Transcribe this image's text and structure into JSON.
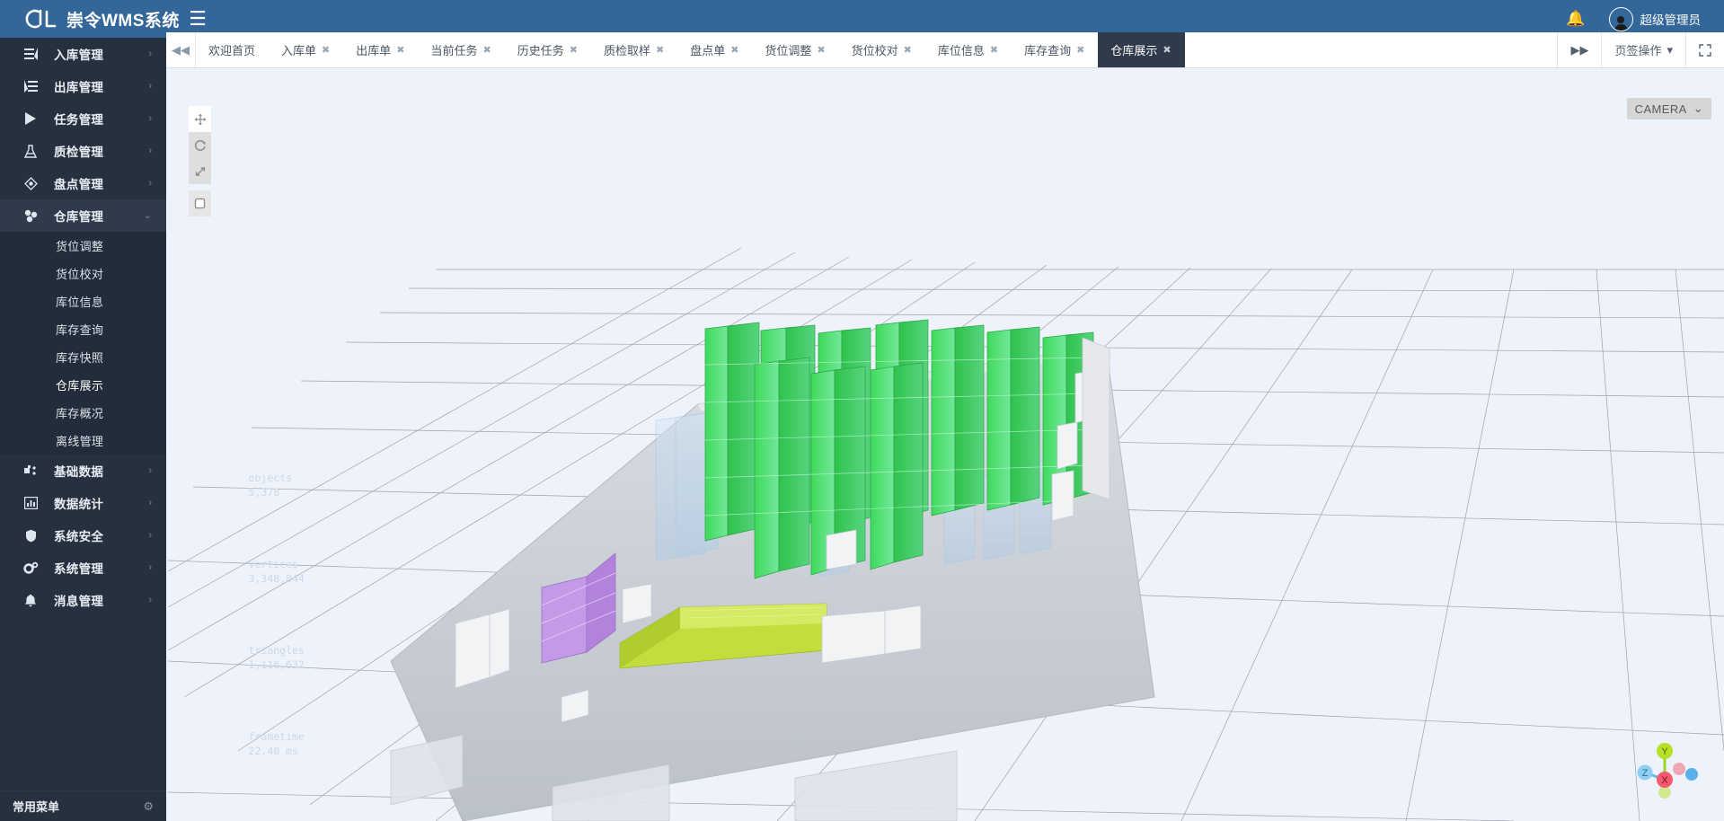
{
  "header": {
    "logo_text": "崇令WMS系统",
    "logo_icon": "cl-logo-icon",
    "hamburger_icon": "hamburger-icon",
    "bell_icon": "bell-icon",
    "user_name": "超级管理员"
  },
  "sidebar": {
    "items": [
      {
        "label": "入库管理",
        "icon": "inbound-icon",
        "arrow": "›",
        "open": false
      },
      {
        "label": "出库管理",
        "icon": "outbound-icon",
        "arrow": "›",
        "open": false
      },
      {
        "label": "任务管理",
        "icon": "play-icon",
        "arrow": "›",
        "open": false
      },
      {
        "label": "质检管理",
        "icon": "flask-icon",
        "arrow": "›",
        "open": false
      },
      {
        "label": "盘点管理",
        "icon": "cube-icon",
        "arrow": "›",
        "open": false
      },
      {
        "label": "仓库管理",
        "icon": "warehouse-icon",
        "arrow": "⌄",
        "open": true
      },
      {
        "label": "基础数据",
        "icon": "data-icon",
        "arrow": "›",
        "open": false
      },
      {
        "label": "数据统计",
        "icon": "chart-icon",
        "arrow": "›",
        "open": false
      },
      {
        "label": "系统安全",
        "icon": "shield-icon",
        "arrow": "›",
        "open": false
      },
      {
        "label": "系统管理",
        "icon": "gears-icon",
        "arrow": "›",
        "open": false
      },
      {
        "label": "消息管理",
        "icon": "bell-icon",
        "arrow": "›",
        "open": false
      }
    ],
    "submenu": [
      {
        "label": "货位调整",
        "active": false
      },
      {
        "label": "货位校对",
        "active": false
      },
      {
        "label": "库位信息",
        "active": false
      },
      {
        "label": "库存查询",
        "active": false
      },
      {
        "label": "库存快照",
        "active": false
      },
      {
        "label": "仓库展示",
        "active": true
      },
      {
        "label": "库存概况",
        "active": false
      },
      {
        "label": "离线管理",
        "active": false
      }
    ],
    "footer": {
      "label": "常用菜单",
      "gear_icon": "gear-icon"
    }
  },
  "tabbar": {
    "prev_icon": "◀◀",
    "next_icon": "▶▶",
    "tabs": [
      {
        "label": "欢迎首页",
        "closable": false,
        "active": false
      },
      {
        "label": "入库单",
        "closable": true,
        "active": false
      },
      {
        "label": "出库单",
        "closable": true,
        "active": false
      },
      {
        "label": "当前任务",
        "closable": true,
        "active": false
      },
      {
        "label": "历史任务",
        "closable": true,
        "active": false
      },
      {
        "label": "质检取样",
        "closable": true,
        "active": false
      },
      {
        "label": "盘点单",
        "closable": true,
        "active": false
      },
      {
        "label": "货位调整",
        "closable": true,
        "active": false
      },
      {
        "label": "货位校对",
        "closable": true,
        "active": false
      },
      {
        "label": "库位信息",
        "closable": true,
        "active": false
      },
      {
        "label": "库存查询",
        "closable": true,
        "active": false
      },
      {
        "label": "仓库展示",
        "closable": true,
        "active": true
      }
    ],
    "close_glyph": "✖",
    "tab_actions_label": "页签操作",
    "tab_actions_caret": "▾",
    "fullscreen_icon": "fullscreen-icon"
  },
  "viewer": {
    "camera_label": "CAMERA",
    "camera_caret": "⌄",
    "tools": [
      {
        "name": "move-tool",
        "glyph": "✥",
        "active": true
      },
      {
        "name": "rotate-tool",
        "glyph": "⟳",
        "active": false
      },
      {
        "name": "scale-tool",
        "glyph": "⤢",
        "active": false
      },
      {
        "name": "select-box-tool",
        "glyph": "▢",
        "active": false
      }
    ],
    "stats": {
      "objects_label": "objects",
      "objects_value": "5,378",
      "vertices_label": "vertices",
      "vertices_value": "3,348,844",
      "triangles_label": "triangles",
      "triangles_value": "1,116,632",
      "frametime_label": "frametime",
      "frametime_value": "22.40 ms"
    },
    "axis": {
      "x": "X",
      "y": "Y",
      "z": "Z"
    },
    "colors": {
      "background": "#eef2fb",
      "floor": "#c9cdd4",
      "rack_green": "#4ee06a",
      "rack_mint": "#63dd8f",
      "rack_purple": "#b58ae0",
      "rack_yellow": "#c8e040",
      "rack_glass": "#b9d6ee",
      "grid_line": "#8a8f99"
    }
  }
}
